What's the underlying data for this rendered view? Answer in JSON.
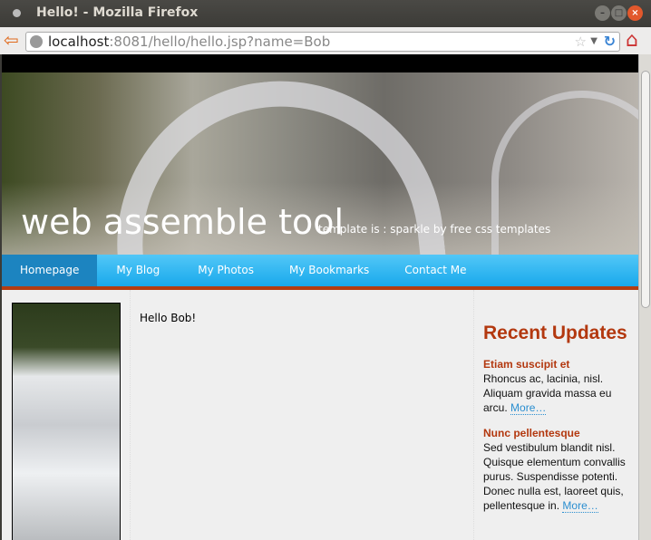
{
  "window": {
    "title": "Hello! - Mozilla Firefox"
  },
  "browser": {
    "url_host": "localhost",
    "url_rest": ":8081/hello/hello.jsp?name=Bob"
  },
  "site": {
    "logo": "web assemble tool",
    "slogan": "template is : sparkle by free css templates"
  },
  "menu": [
    {
      "label": "Homepage",
      "active": true
    },
    {
      "label": "My Blog"
    },
    {
      "label": "My Photos"
    },
    {
      "label": "My Bookmarks"
    },
    {
      "label": "Contact Me"
    }
  ],
  "main": {
    "greeting": "Hello Bob!"
  },
  "sidebar": {
    "title": "Recent Updates",
    "items": [
      {
        "title": "Etiam suscipit et",
        "text": "Rhoncus ac, lacinia, nisl. Aliquam gravida massa eu arcu.",
        "more": "More…"
      },
      {
        "title": "Nunc pellentesque",
        "text": "Sed vestibulum blandit nisl. Quisque elementum convallis purus. Suspendisse potenti. Donec nulla est, laoreet quis, pellentesque in.",
        "more": "More…"
      }
    ]
  },
  "colors": {
    "accent": "#b3380f",
    "menu": "#19a9ec",
    "link": "#2a8ed0"
  }
}
